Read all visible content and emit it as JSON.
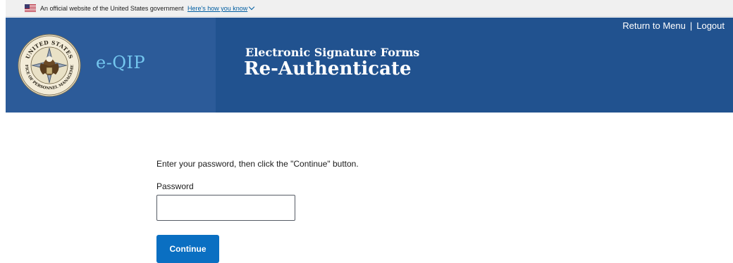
{
  "gov_banner": {
    "text": "An official website of the United States government",
    "link": "Here's how you know"
  },
  "header": {
    "app_name": "e-QIP",
    "forms_title": "Electronic Signature Forms",
    "page_title": "Re-Authenticate",
    "return_link": "Return to Menu",
    "separator": "|",
    "logout_link": "Logout",
    "seal": {
      "top_text": "UNITED STATES",
      "bottom_text": "OFFICE OF PERSONNEL MANAGEMENT"
    }
  },
  "main": {
    "instructions": "Enter your password, then click the \"Continue\" button.",
    "password_label": "Password",
    "password_value": "",
    "continue_label": "Continue"
  },
  "colors": {
    "header_bg": "#21528f",
    "header_left_bg": "#2c5b99",
    "app_name": "#74c7ef",
    "button": "#0a6fc2",
    "link": "#005ea2"
  }
}
